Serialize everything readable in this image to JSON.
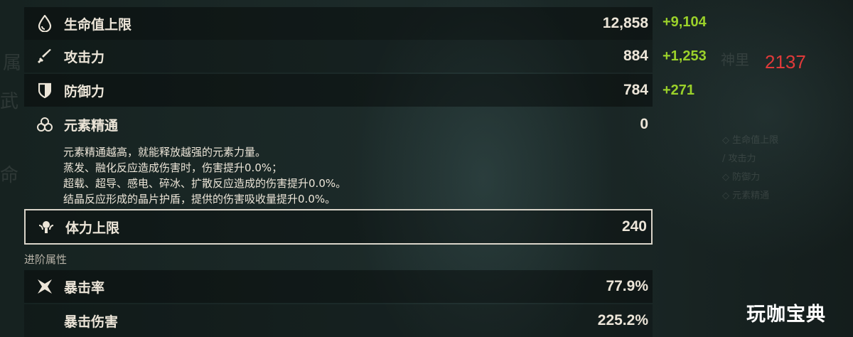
{
  "stats": [
    {
      "key": "hp",
      "label": "生命值上限",
      "value": "12,858",
      "bonus": "+9,104",
      "icon": "droplet-icon"
    },
    {
      "key": "atk",
      "label": "攻击力",
      "value": "884",
      "bonus": "+1,253",
      "icon": "sword-icon"
    },
    {
      "key": "def",
      "label": "防御力",
      "value": "784",
      "bonus": "+271",
      "icon": "shield-icon"
    },
    {
      "key": "em",
      "label": "元素精通",
      "value": "0",
      "icon": "elemental-mastery-icon"
    }
  ],
  "em_description": [
    "元素精通越高，就能释放越强的元素力量。",
    "蒸发、融化反应造成伤害时，伤害提升0.0%；",
    "超载、超导、感电、碎冰、扩散反应造成的伤害提升0.0%。",
    "结晶反应形成的晶片护盾，提供的伤害吸收量提升0.0%。"
  ],
  "stamina": {
    "label": "体力上限",
    "value": "240",
    "icon": "stamina-icon"
  },
  "advanced_section": "进阶属性",
  "advanced": [
    {
      "key": "crit_rate",
      "label": "暴击率",
      "value": "77.9%",
      "icon": "crit-icon"
    },
    {
      "key": "crit_dmg",
      "label": "暴击伤害",
      "value": "225.2%"
    }
  ],
  "annotation": "2137",
  "watermark": "玩咖宝典",
  "colors": {
    "bonus": "#9bd12a",
    "annotation": "#e03a3a",
    "text": "#ece5d8"
  }
}
